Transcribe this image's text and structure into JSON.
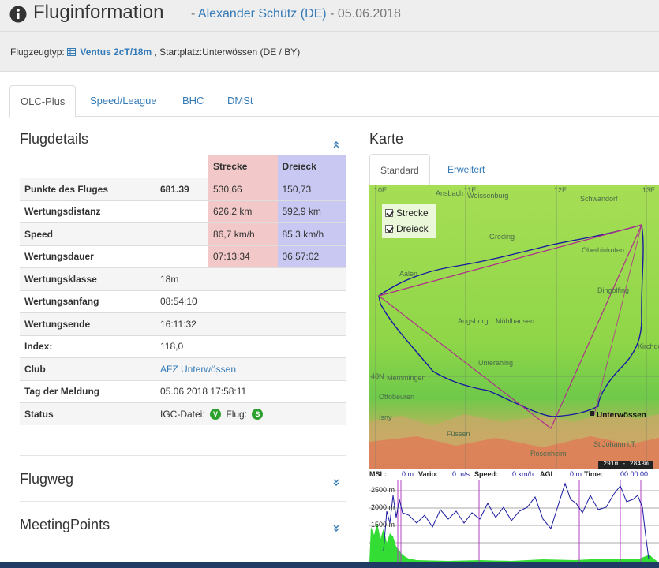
{
  "header": {
    "title": "Fluginformation",
    "sub_prefix": "-",
    "pilot": "Alexander Schütz (DE)",
    "date": "- 05.06.2018"
  },
  "subheader": {
    "plane_label": "Flugzeugtyp:",
    "plane": "Ventus 2cT/18m",
    "start_text": ", Startplatz:Unterwössen (DE / BY)"
  },
  "tabs": [
    "OLC-Plus",
    "Speed/League",
    "BHC",
    "DMSt"
  ],
  "flugdetails": {
    "title": "Flugdetails",
    "col_strecke": "Strecke",
    "col_dreieck": "Dreieck",
    "rows_split": [
      {
        "label": "Punkte des Fluges",
        "value": "681.39",
        "strecke": "530,66",
        "dreieck": "150,73"
      },
      {
        "label": "Wertungsdistanz",
        "value": "",
        "strecke": "626,2 km",
        "dreieck": "592,9 km"
      },
      {
        "label": "Speed",
        "value": "",
        "strecke": "86,7 km/h",
        "dreieck": "85,3 km/h"
      },
      {
        "label": "Wertungsdauer",
        "value": "",
        "strecke": "07:13:34",
        "dreieck": "06:57:02"
      }
    ],
    "rows": [
      {
        "label": "Wertungsklasse",
        "value": "18m"
      },
      {
        "label": "Wertungsanfang",
        "value": "08:54:10"
      },
      {
        "label": "Wertungsende",
        "value": "16:11:32"
      },
      {
        "label": "Index:",
        "value": "118,0"
      },
      {
        "label": "Club",
        "value": "AFZ Unterwössen"
      },
      {
        "label": "Tag der Meldung",
        "value": "05.06.2018 17:58:11"
      }
    ],
    "status_label": "Status",
    "status_igc": "IGC-Datei:",
    "status_igc_badge": "V",
    "status_flug": "Flug:",
    "status_flug_badge": "S"
  },
  "flugweg": {
    "title": "Flugweg"
  },
  "meetingpoints": {
    "title": "MeetingPoints"
  },
  "karte": {
    "title": "Karte",
    "tabs": [
      "Standard",
      "Erweitert"
    ],
    "legend": [
      "Strecke",
      "Dreieck"
    ],
    "grid_labels": [
      "10E",
      "11E",
      "12E",
      "13E",
      "48N"
    ],
    "places": [
      "Ansbach",
      "Weissenburg",
      "Schwandorf",
      "Greding",
      "Oberhinkofen",
      "Aalen",
      "Dingolfing",
      "Augsburg",
      "Mühlhausen",
      "Unterahing",
      "Kirchdorf",
      "Memmingen",
      "Ottobeuren",
      "Isny",
      "Füssen",
      "Unterwössen",
      "St Johann i.T.",
      "Rosenheim"
    ],
    "scale": "291m - 2843m",
    "colors": {
      "track": "#1a1aa0",
      "strecke": "#b0308c",
      "dreieck": "#b0308c",
      "terrain": "#8fd648"
    }
  },
  "barogramm": {
    "msl_label": "MSL:",
    "msl": "0 m",
    "vario_label": "Vario:",
    "vario": "0 m/s",
    "speed_label": "Speed:",
    "speed": "0 km/h",
    "agl_label": "AGL:",
    "agl": "0 m",
    "time_label": "Time:",
    "time": "00:00:00",
    "y_ticks": [
      "2500 m",
      "2000 m",
      "1500 m"
    ]
  }
}
